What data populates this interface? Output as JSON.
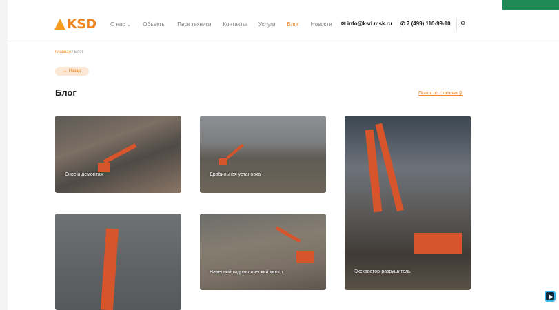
{
  "header": {
    "logo_text": "KSD",
    "nav": [
      {
        "label": "О нас ⌄",
        "active": false
      },
      {
        "label": "Объекты",
        "active": false
      },
      {
        "label": "Парк техники",
        "active": false
      },
      {
        "label": "Контакты",
        "active": false
      },
      {
        "label": "Услуги",
        "active": false
      },
      {
        "label": "Блог",
        "active": true
      },
      {
        "label": "Новости",
        "active": false
      }
    ],
    "email": "✉ info@ksd.msk.ru",
    "phone": "✆ 7 (499) 110-99-10",
    "search_icon": "⚲"
  },
  "breadcrumb": {
    "home": "Главная",
    "separator": "/",
    "current": "Блог"
  },
  "back_button": "← Назад",
  "page_title": "Блог",
  "search_articles": "Поиск по статьям ⚲",
  "cards": [
    {
      "title": "Снос и демонтаж"
    },
    {
      "title": "Дробильная установка"
    },
    {
      "title": "Экскаватор-разрушитель"
    },
    {
      "title": ""
    },
    {
      "title": "Навесной гидравлический молот"
    }
  ],
  "colors": {
    "accent": "#f0841c",
    "brand_green": "#1f8a55"
  }
}
